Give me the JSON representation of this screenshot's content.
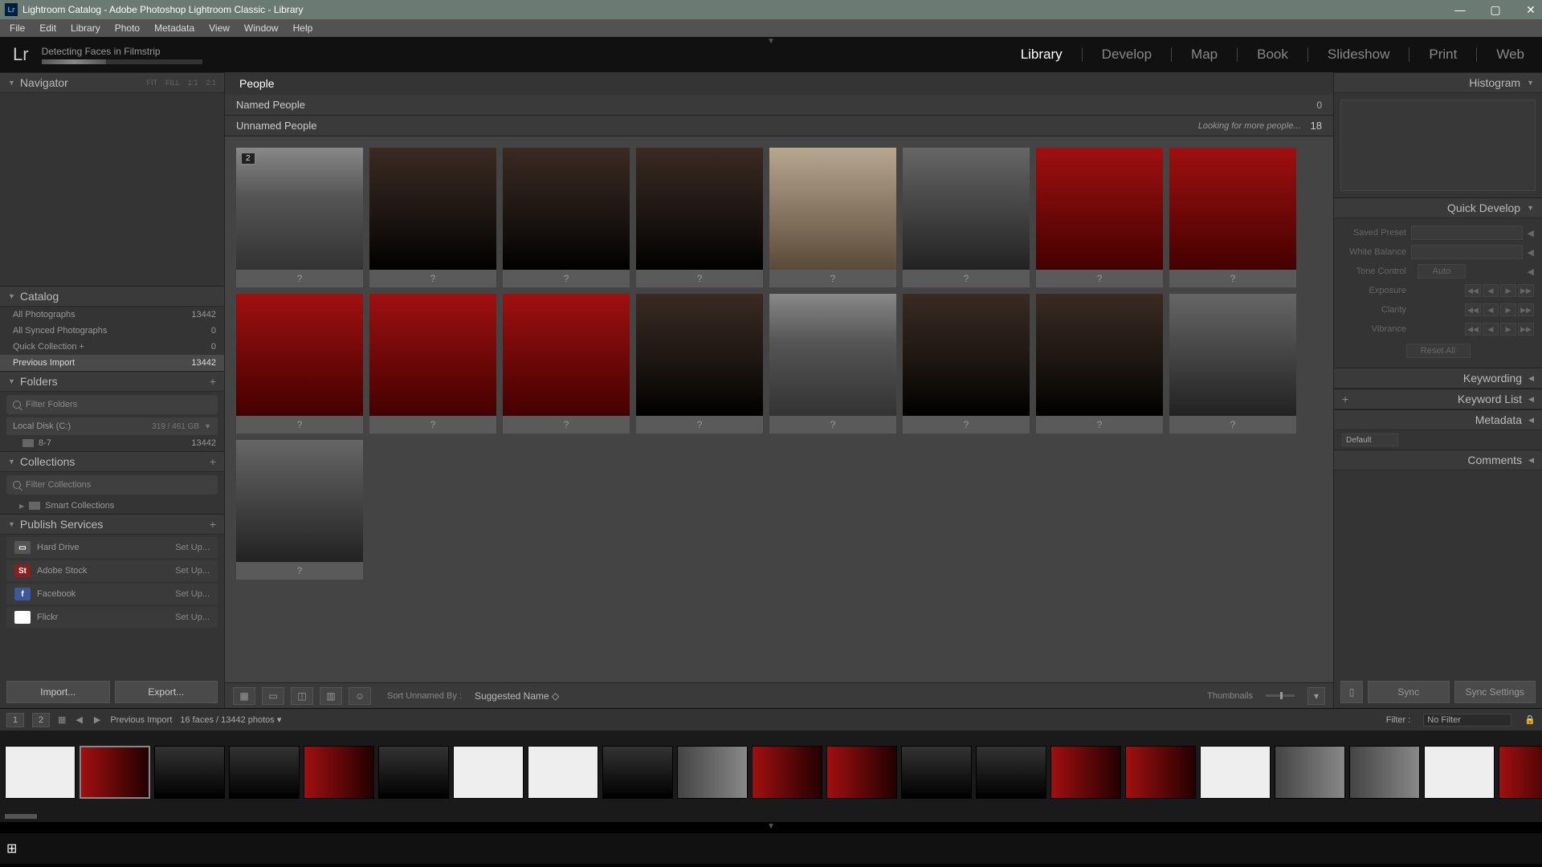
{
  "window": {
    "title": "Lightroom Catalog - Adobe Photoshop Lightroom Classic - Library"
  },
  "menu": [
    "File",
    "Edit",
    "Library",
    "Photo",
    "Metadata",
    "View",
    "Window",
    "Help"
  ],
  "status": {
    "text": "Detecting Faces in Filmstrip"
  },
  "modules": [
    "Library",
    "Develop",
    "Map",
    "Book",
    "Slideshow",
    "Print",
    "Web"
  ],
  "modules_active": 0,
  "left": {
    "navigator": {
      "label": "Navigator",
      "zoom": [
        "FIT",
        "FILL",
        "1:1",
        "2:1"
      ]
    },
    "catalog": {
      "label": "Catalog",
      "items": [
        {
          "label": "All Photographs",
          "count": "13442"
        },
        {
          "label": "All Synced Photographs",
          "count": "0"
        },
        {
          "label": "Quick Collection  +",
          "count": "0"
        },
        {
          "label": "Previous Import",
          "count": "13442"
        }
      ],
      "selected": 3
    },
    "folders": {
      "label": "Folders",
      "filter_placeholder": "Filter Folders",
      "disk": {
        "label": "Local Disk (C:)",
        "cap": "319 / 461 GB"
      },
      "folder": {
        "label": "8-7",
        "count": "13442"
      }
    },
    "collections": {
      "label": "Collections",
      "filter_placeholder": "Filter Collections",
      "smart": "Smart Collections"
    },
    "publish": {
      "label": "Publish Services",
      "items": [
        {
          "label": "Hard Drive",
          "icon_bg": "#555",
          "icon_txt": "▭"
        },
        {
          "label": "Adobe Stock",
          "icon_bg": "#8a1f1f",
          "icon_txt": "St"
        },
        {
          "label": "Facebook",
          "icon_bg": "#3b5998",
          "icon_txt": "f"
        },
        {
          "label": "Flickr",
          "icon_bg": "#fff",
          "icon_txt": "••"
        }
      ],
      "setup": "Set Up..."
    },
    "import_btn": "Import...",
    "export_btn": "Export..."
  },
  "center": {
    "tab": "People",
    "named": {
      "label": "Named People",
      "count": "0"
    },
    "unnamed": {
      "label": "Unnamed People",
      "count": "18",
      "looking": "Looking for more people..."
    },
    "faces": [
      {
        "badge": "2",
        "v": "v1"
      },
      {
        "v": "v2"
      },
      {
        "v": "v2"
      },
      {
        "v": "v2"
      },
      {
        "v": "v5"
      },
      {
        "v": "v4"
      },
      {
        "v": "v3"
      },
      {
        "v": "v3"
      },
      {
        "v": "v3"
      },
      {
        "v": "v3"
      },
      {
        "v": "v3"
      },
      {
        "v": "v2"
      },
      {
        "v": "v1"
      },
      {
        "v": "v2"
      },
      {
        "v": "v2"
      },
      {
        "v": "v4"
      },
      {
        "v": "v4"
      }
    ],
    "face_name": "?",
    "sort_label": "Sort Unnamed By :",
    "sort_value": "Suggested Name",
    "thumbnails_label": "Thumbnails"
  },
  "right": {
    "histogram": "Histogram",
    "quickdev": {
      "label": "Quick Develop",
      "saved": "Saved Preset",
      "wb": "White Balance",
      "tone": "Tone Control",
      "auto": "Auto",
      "exposure": "Exposure",
      "clarity": "Clarity",
      "vibrance": "Vibrance",
      "reset": "Reset All"
    },
    "keywording": "Keywording",
    "keywordlist": "Keyword List",
    "metadata": "Metadata",
    "meta_preset": "Default",
    "comments": "Comments",
    "sync": "Sync",
    "sync_settings": "Sync Settings"
  },
  "filmbar": {
    "pages": [
      "1",
      "2"
    ],
    "breadcrumb": "Previous Import",
    "info": "16 faces / 13442 photos",
    "filter_label": "Filter :",
    "filter_value": "No Filter"
  },
  "filmstrip_variants": [
    "tv2",
    "tv1",
    "tv3",
    "tv3",
    "tv1",
    "tv3",
    "tv2",
    "tv2",
    "tv3",
    "tv4",
    "tv1",
    "tv1",
    "tv3",
    "tv3",
    "tv1",
    "tv1",
    "tv2",
    "tv4",
    "tv4",
    "tv2",
    "tv1"
  ]
}
